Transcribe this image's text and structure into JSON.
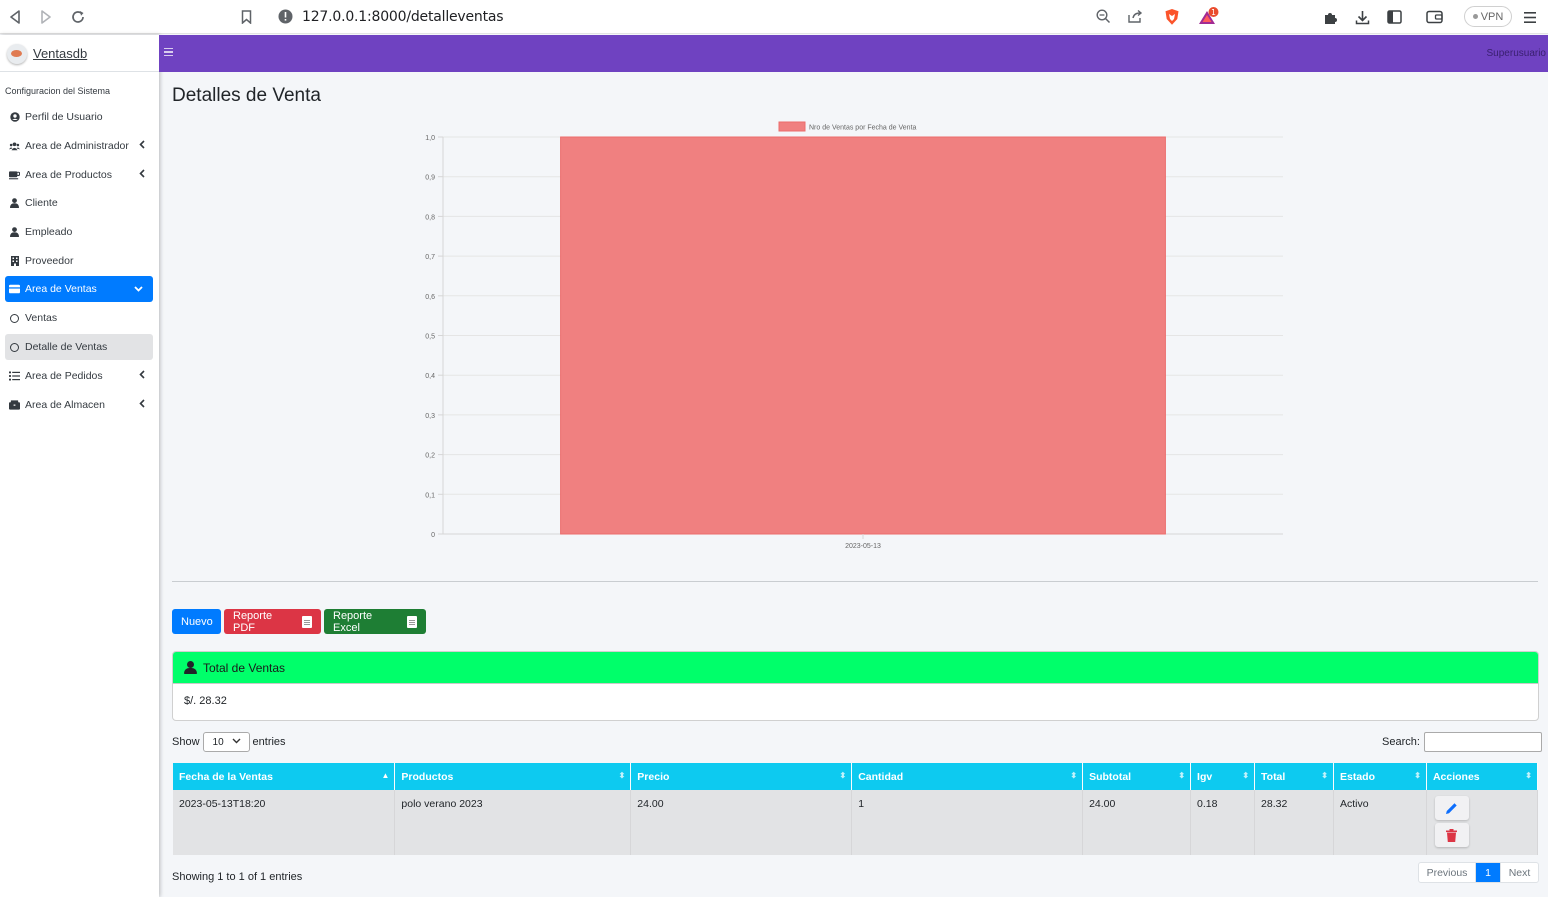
{
  "browser": {
    "url": "127.0.0.1:8000/detalleventas",
    "vpn_label": "VPN",
    "shield_badge": "1"
  },
  "brand": {
    "name": "Ventasdb"
  },
  "sidebar": {
    "header": "Configuracion del Sistema",
    "items": [
      {
        "label": "Perfil de Usuario",
        "icon": "user-circle-icon",
        "chevron": false
      },
      {
        "label": "Area de Administrador",
        "icon": "users-icon",
        "chevron": true
      },
      {
        "label": "Area de Productos",
        "icon": "mug-icon",
        "chevron": true
      },
      {
        "label": "Cliente",
        "icon": "user-icon",
        "chevron": false
      },
      {
        "label": "Empleado",
        "icon": "user-icon",
        "chevron": false
      },
      {
        "label": "Proveedor",
        "icon": "building-icon",
        "chevron": false
      },
      {
        "label": "Area de Ventas",
        "icon": "cash-register-icon",
        "chevron": true,
        "active": true
      },
      {
        "label": "Ventas",
        "icon": "circle-icon",
        "chevron": false
      },
      {
        "label": "Detalle de Ventas",
        "icon": "circle-icon",
        "chevron": false,
        "selected": true
      },
      {
        "label": "Area de Pedidos",
        "icon": "list-icon",
        "chevron": true
      },
      {
        "label": "Area de Almacen",
        "icon": "warehouse-icon",
        "chevron": true
      }
    ]
  },
  "topnav": {
    "user": "Superusuario"
  },
  "page": {
    "title": "Detalles de Venta"
  },
  "chart_data": {
    "type": "bar",
    "categories": [
      "2023-05-13"
    ],
    "series": [
      {
        "name": "Nro de Ventas por Fecha de Venta",
        "values": [
          1
        ],
        "color": "#f08080"
      }
    ],
    "ylim": [
      0,
      1
    ],
    "yticks": [
      "0",
      "0,1",
      "0,2",
      "0,3",
      "0,4",
      "0,5",
      "0,6",
      "0,7",
      "0,8",
      "0,9",
      "1,0"
    ],
    "grid": true,
    "legend": "top-center"
  },
  "buttons": {
    "nuevo": "Nuevo",
    "pdf": "Reporte PDF",
    "excel": "Reporte Excel"
  },
  "total_card": {
    "title": "Total de Ventas",
    "value": "$/. 28.32"
  },
  "datatable": {
    "show_label": "Show",
    "entries_label": "entries",
    "page_length": "10",
    "search_label": "Search:",
    "columns": [
      "Fecha de la Ventas",
      "Productos",
      "Precio",
      "Cantidad",
      "Subtotal",
      "Igv",
      "Total",
      "Estado",
      "Acciones"
    ],
    "rows": [
      [
        "2023-05-13T18:20",
        "polo verano 2023",
        "24.00",
        "1",
        "24.00",
        "0.18",
        "28.32",
        "Activo"
      ]
    ],
    "info": "Showing 1 to 1 of 1 entries",
    "prev": "Previous",
    "current_page": "1",
    "next": "Next"
  },
  "colors": {
    "navbar": "#6f42c1",
    "primary": "#007bff",
    "danger": "#dc3545",
    "success": "#1e7e34",
    "card_header": "#00ff6a",
    "table_header": "#0dcaf0",
    "bar": "#f08080"
  }
}
